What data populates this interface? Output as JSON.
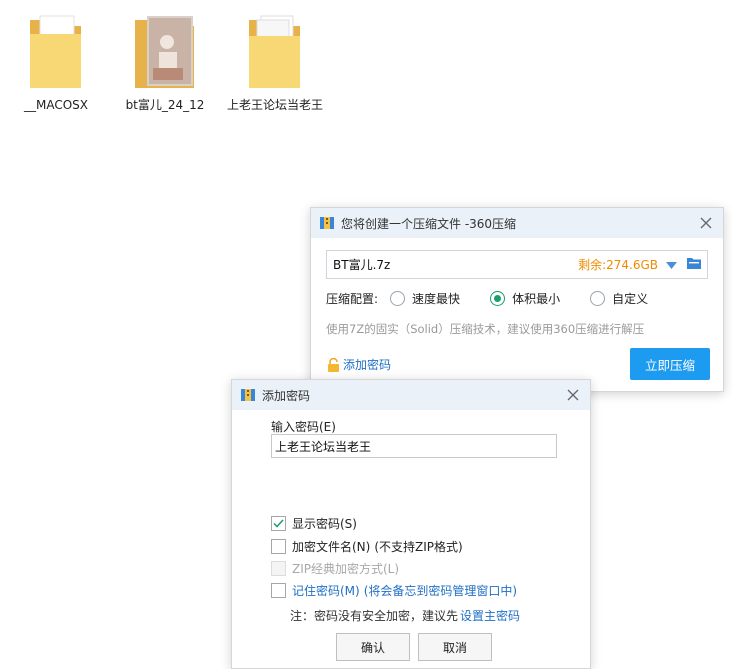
{
  "desktop": {
    "folders": [
      {
        "label": "__MACOSX"
      },
      {
        "label": "bt富儿_24_12"
      },
      {
        "label": "上老王论坛当老王"
      }
    ]
  },
  "compress_dialog": {
    "title": "您将创建一个压缩文件 -360压缩",
    "filename": "BT富儿.7z",
    "free_space": "剩余:274.6GB",
    "config_label": "压缩配置:",
    "options": [
      {
        "label": "速度最快",
        "selected": false
      },
      {
        "label": "体积最小",
        "selected": true
      },
      {
        "label": "自定义",
        "selected": false
      }
    ],
    "hint": "使用7Z的固实（Solid）压缩技术，建议使用360压缩进行解压",
    "add_password": "添加密码",
    "compress_button": "立即压缩"
  },
  "password_dialog": {
    "title": "添加密码",
    "input_label": "输入密码(E)",
    "password_value": "上老王论坛当老王",
    "checkboxes": [
      {
        "label": "显示密码(S)",
        "checked": true,
        "enabled": true
      },
      {
        "label": "加密文件名(N)",
        "sub": "(不支持ZIP格式)",
        "checked": false,
        "enabled": true
      },
      {
        "label": "ZIP经典加密方式(L)",
        "checked": false,
        "enabled": false
      },
      {
        "label": "记住密码(M)",
        "sub": "(将会备忘到密码管理窗口中)",
        "checked": false,
        "enabled": true
      }
    ],
    "note": "注：密码没有安全加密，建议先",
    "note_link": "设置主密码",
    "ok_button": "确认",
    "cancel_button": "取消"
  },
  "colors": {
    "accent_blue": "#1c9bf0",
    "link_blue": "#1f6fc4",
    "free_space_orange": "#f08a00",
    "radio_green": "#1a9e6a",
    "titlebar_bg": "#eaf1f8"
  }
}
